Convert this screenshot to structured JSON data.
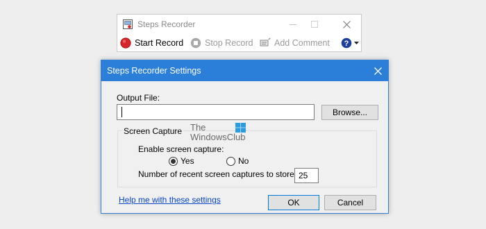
{
  "recorder": {
    "title": "Steps Recorder",
    "start_record": "Start Record",
    "stop_record": "Stop Record",
    "add_comment": "Add Comment",
    "help_icon": "help-icon"
  },
  "dialog": {
    "title": "Steps Recorder Settings",
    "output_file_label": "Output File:",
    "output_file_value": "",
    "browse_label": "Browse...",
    "screen_capture_legend": "Screen Capture",
    "enable_capture_label": "Enable screen capture:",
    "yes_label": "Yes",
    "no_label": "No",
    "enable_capture_selected": "Yes",
    "capture_count_label": "Number of recent screen captures to store:",
    "capture_count_value": "25",
    "help_link": "Help me with these settings",
    "ok_label": "OK",
    "cancel_label": "Cancel"
  },
  "watermark": {
    "line1": "The",
    "line2": "WindowsClub"
  },
  "colors": {
    "dialog_titlebar": "#2b7fd9",
    "record_red": "#d6262b",
    "link_blue": "#0645c5"
  }
}
